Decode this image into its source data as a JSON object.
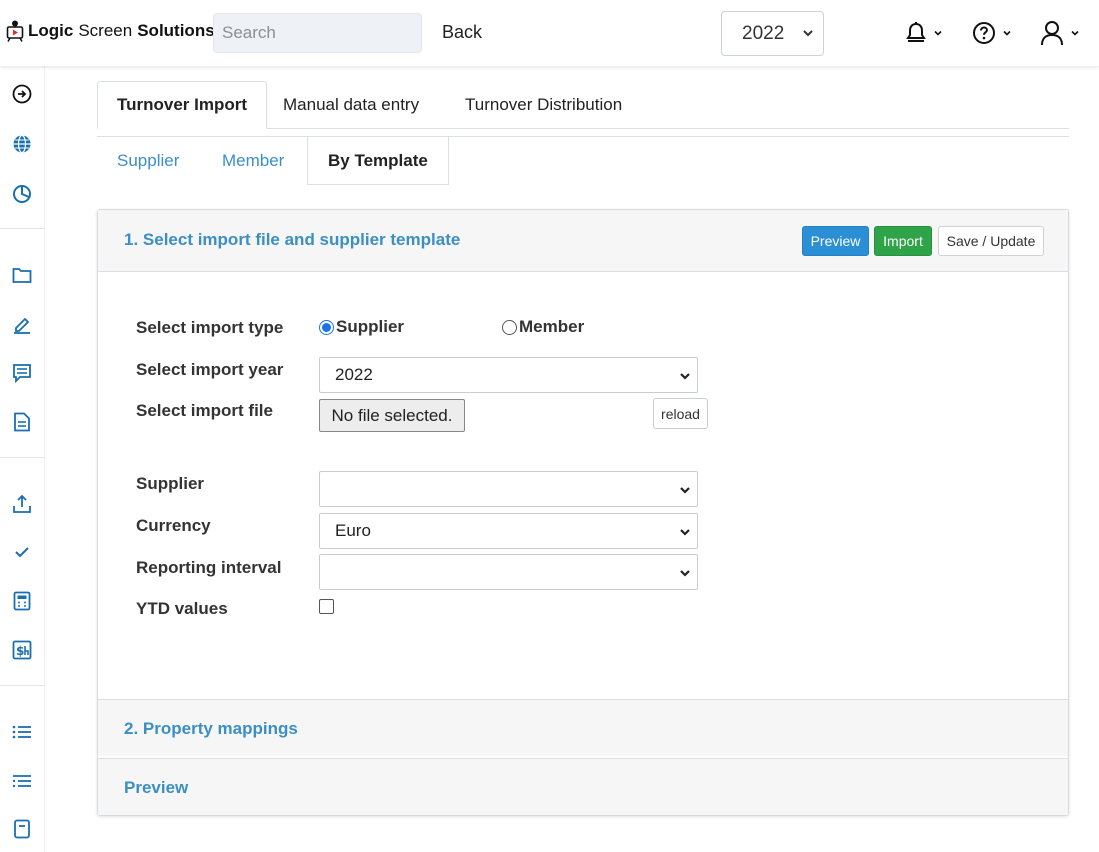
{
  "app": {
    "logo": {
      "word1": "Logic",
      "word2": "Screen",
      "word3": "Solutions"
    },
    "search": {
      "placeholder": "Search",
      "value": ""
    },
    "back_label": "Back",
    "year": "2022"
  },
  "header_icons": [
    "bell-icon",
    "help-icon",
    "user-icon"
  ],
  "sidebar": {
    "icons": [
      "arrow-circle-right-icon",
      "globe-icon",
      "pie-chart-icon",
      "folder-icon",
      "pencil-icon",
      "message-list-icon",
      "document-icon",
      "upload-icon",
      "check-icon",
      "calculator-icon",
      "invoice-dollar-icon",
      "list-icon",
      "indented-list-icon",
      "bookmark-icon"
    ]
  },
  "tabs": [
    {
      "label": "Turnover Import",
      "active": true
    },
    {
      "label": "Manual data entry",
      "active": false
    },
    {
      "label": "Turnover Distribution",
      "active": false
    }
  ],
  "subtabs": [
    {
      "label": "Supplier",
      "active": false
    },
    {
      "label": "Member",
      "active": false
    },
    {
      "label": "By Template",
      "active": true
    }
  ],
  "panel": {
    "title": "1. Select import file and supplier template",
    "buttons": {
      "preview": "Preview",
      "import": "Import",
      "save": "Save / Update"
    },
    "colors": {
      "preview": "#2b8fd6",
      "import": "#2fa347",
      "link": "#3b8fc4"
    }
  },
  "form": {
    "import_type_label": "Select import type",
    "import_type_options": [
      {
        "label": "Supplier",
        "checked": true
      },
      {
        "label": "Member",
        "checked": false
      }
    ],
    "import_year_label": "Select import year",
    "import_year_value": "2022",
    "import_file_label": "Select import file",
    "file_button_text": "No file selected.",
    "reload_label": "reload",
    "supplier_label": "Supplier",
    "supplier_value": "",
    "currency_label": "Currency",
    "currency_value": "Euro",
    "interval_label": "Reporting interval",
    "interval_value": "",
    "ytd_label": "YTD values",
    "ytd_checked": false
  },
  "sections": {
    "mappings": "2. Property mappings",
    "preview": "Preview"
  }
}
